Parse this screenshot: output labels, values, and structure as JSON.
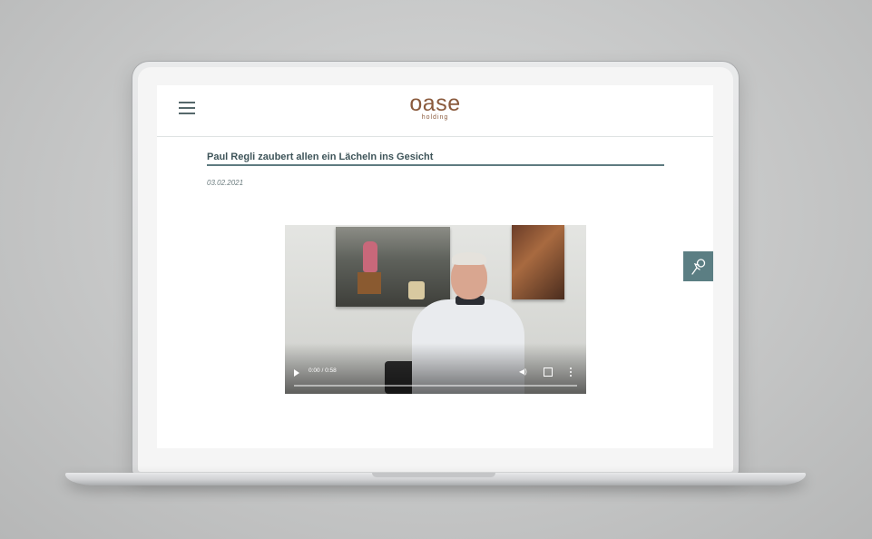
{
  "site": {
    "logo": "oase",
    "logo_sub": "holding",
    "menu_icon": "hamburger-menu-icon"
  },
  "article": {
    "title": "Paul Regli zaubert allen ein Lächeln ins Gesicht",
    "date": "03.02.2021"
  },
  "video": {
    "time": "0:00 / 0:58",
    "progress": 0,
    "icons": [
      "play-icon",
      "volume-icon",
      "fullscreen-icon",
      "more-options-icon"
    ]
  },
  "side_widget": {
    "icon": "accessibility-icon"
  },
  "colors": {
    "brand": "#8a5a3c",
    "accent": "#5b7e83",
    "title": "#3e5459"
  }
}
